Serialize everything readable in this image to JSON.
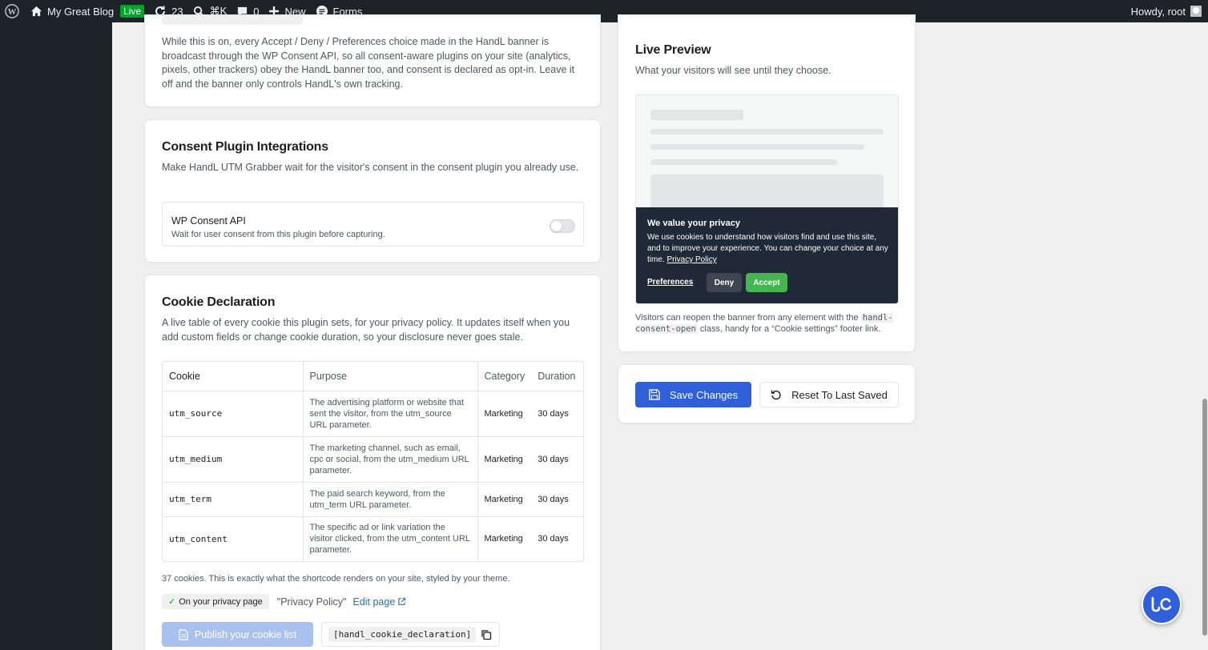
{
  "adminbar": {
    "site_name": "My Great Blog",
    "live_badge": "Live",
    "updates_count": "23",
    "search_shortcut": "⌘K",
    "comments_count": "0",
    "new_label": "New",
    "forms_label": "Forms",
    "greeting": "Howdy, root"
  },
  "wp_consent_card": {
    "description": "While this is on, every Accept / Deny / Preferences choice made in the HandL banner is broadcast through the WP Consent API, so all consent-aware plugins on your site (analytics, pixels, other trackers) obey the HandL banner too, and consent is declared as opt-in. Leave it off and the banner only controls HandL's own tracking."
  },
  "integrations": {
    "title": "Consent Plugin Integrations",
    "description": "Make HandL UTM Grabber wait for the visitor's consent in the consent plugin you already use.",
    "items": [
      {
        "name": "WP Consent API",
        "subtitle": "Wait for user consent from this plugin before capturing.",
        "enabled": false
      }
    ]
  },
  "cookie_declaration": {
    "title": "Cookie Declaration",
    "description": "A live table of every cookie this plugin sets, for your privacy policy. It updates itself when you add custom fields or change cookie duration, so your disclosure never goes stale.",
    "columns": [
      "Cookie",
      "Purpose",
      "Category",
      "Duration"
    ],
    "rows": [
      {
        "cookie": "utm_source",
        "purpose": "The advertising platform or website that sent the visitor, from the utm_source URL parameter.",
        "category": "Marketing",
        "duration": "30 days"
      },
      {
        "cookie": "utm_medium",
        "purpose": "The marketing channel, such as email, cpc or social, from the utm_medium URL parameter.",
        "category": "Marketing",
        "duration": "30 days"
      },
      {
        "cookie": "utm_term",
        "purpose": "The paid search keyword, from the utm_term URL parameter.",
        "category": "Marketing",
        "duration": "30 days"
      },
      {
        "cookie": "utm_content",
        "purpose": "The specific ad or link variation the visitor clicked, from the utm_content URL parameter.",
        "category": "Marketing",
        "duration": "30 days"
      }
    ],
    "count_note": "37 cookies. This is exactly what the shortcode renders on your site, styled by your theme.",
    "status_label": "On your privacy page",
    "page_name": "\"Privacy Policy\"",
    "edit_link": "Edit page",
    "publish_label": "Publish your cookie list",
    "shortcode": "[handl_cookie_declaration]"
  },
  "preview": {
    "title": "Live Preview",
    "description": "What your visitors will see until they choose.",
    "banner": {
      "title": "We value your privacy",
      "text": "We use cookies to understand how visitors find and use this site, and to improve your experience. You can change your choice at any time.",
      "policy_link": "Privacy Policy",
      "preferences": "Preferences",
      "deny": "Deny",
      "accept": "Accept"
    },
    "note_prefix": "Visitors can reopen the banner from any element with the",
    "note_code": "handl-consent-open",
    "note_suffix": "class, handy for a “Cookie settings” footer link."
  },
  "actions": {
    "save": "Save Changes",
    "reset": "Reset To Last Saved"
  },
  "colors": {
    "primary": "#2f5fd9",
    "adminbar": "#1d2327",
    "accept": "#46b450",
    "banner": "#1f2937"
  }
}
